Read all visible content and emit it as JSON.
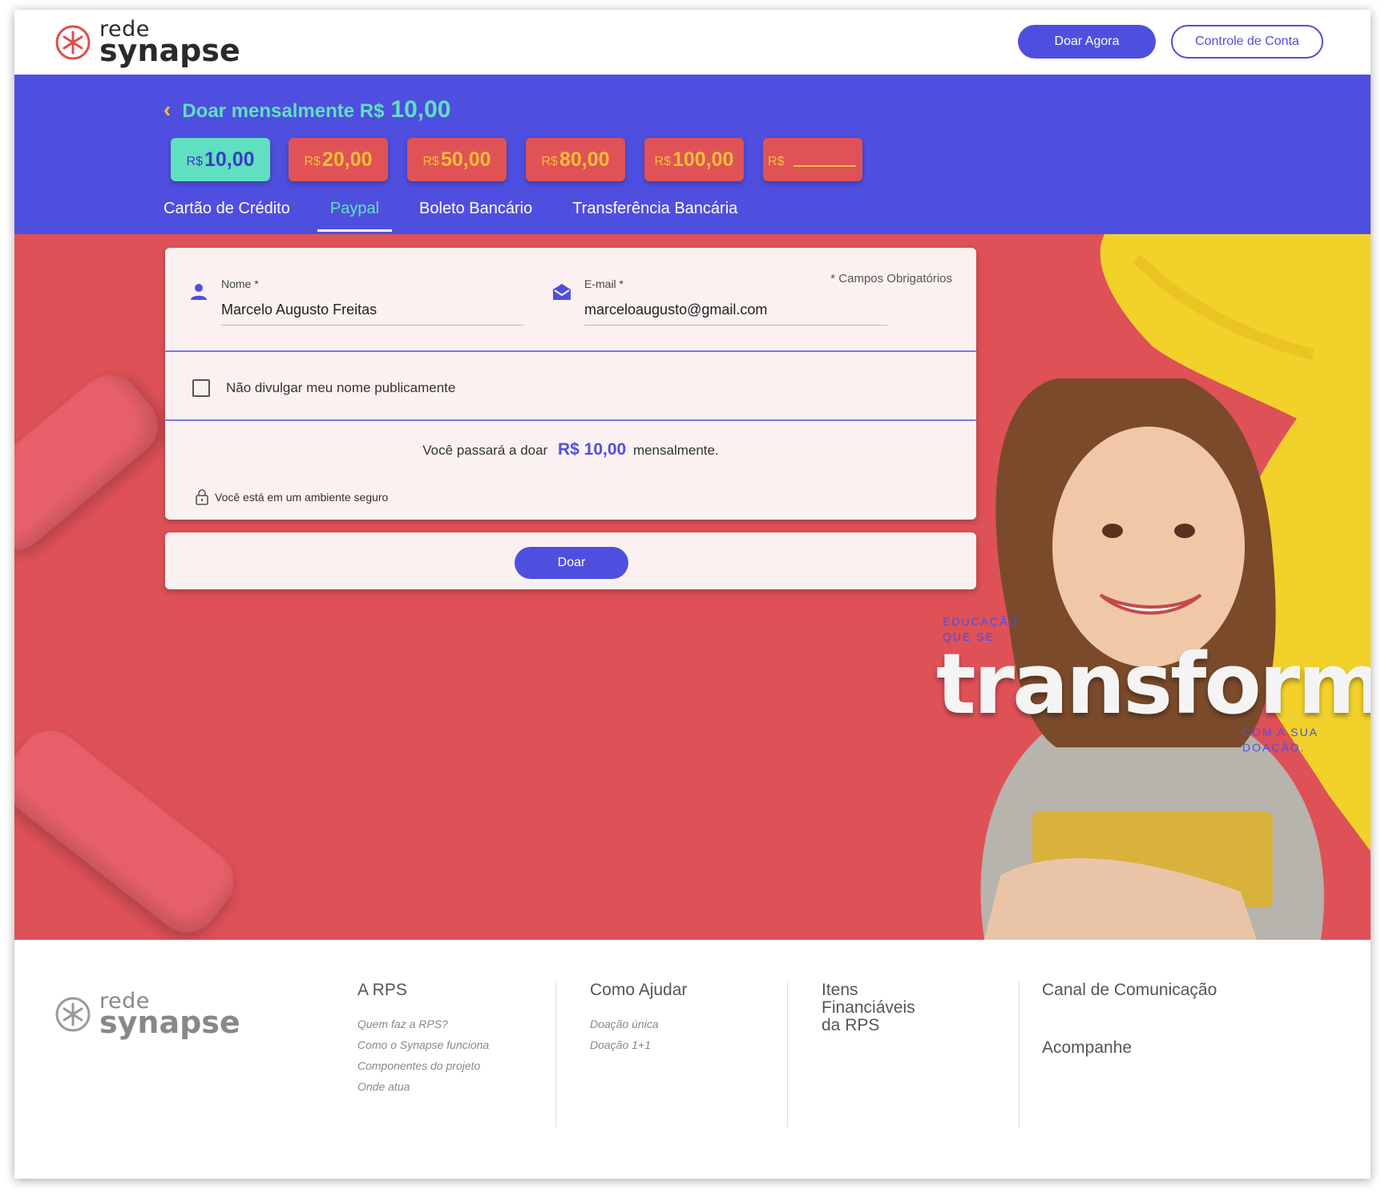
{
  "header": {
    "logo_line1": "rede",
    "logo_line2": "synapse",
    "donate_button": "Doar Agora",
    "account_button": "Controle de Conta"
  },
  "donation": {
    "title": "Doar mensalmente R$",
    "amount": "10,00",
    "currency": "R$",
    "options": [
      {
        "value": "10,00",
        "selected": true
      },
      {
        "value": "20,00",
        "selected": false
      },
      {
        "value": "50,00",
        "selected": false
      },
      {
        "value": "80,00",
        "selected": false
      },
      {
        "value": "100,00",
        "selected": false
      }
    ],
    "custom_currency": "R$"
  },
  "payment_tabs": [
    {
      "label": "Cartão de Crédito",
      "active": false
    },
    {
      "label": "Paypal",
      "active": true
    },
    {
      "label": "Boleto Bancário",
      "active": false
    },
    {
      "label": "Transferência Bancária",
      "active": false
    }
  ],
  "form": {
    "required_note": "* Campos Obrigatórios",
    "name_label": "Nome *",
    "name_value": "Marcelo Augusto Freitas",
    "email_label": "E-mail *",
    "email_value": "marceloaugusto@gmail.com",
    "anonymous_label": "Não divulgar meu nome publicamente",
    "anonymous_checked": false,
    "summary_prefix": "Você passará a doar",
    "summary_amount": "R$ 10,00",
    "summary_suffix": "mensalmente.",
    "secure_text": "Você está em um ambiente seguro",
    "submit_label": "Doar"
  },
  "hero": {
    "slogan_top_1": "EDUCAÇÃO",
    "slogan_top_2": "QUE SE",
    "slogan_main": "transforma",
    "slogan_bottom_1": "COM A SUA",
    "slogan_bottom_2": "DOAÇÃO."
  },
  "footer": {
    "logo_line1": "rede",
    "logo_line2": "synapse",
    "col1": {
      "title": "A RPS",
      "links": [
        "Quem faz a RPS?",
        "Como o Synapse funciona",
        "Componentes do projeto",
        "Onde atua"
      ]
    },
    "col2": {
      "title": "Como Ajudar",
      "links": [
        "Doação única",
        "Doação 1+1"
      ]
    },
    "col3": {
      "title_1": "Itens",
      "title_2": "Financiáveis",
      "title_3": "da RPS"
    },
    "col4": {
      "title": "Canal de Comunicação",
      "title_2": "Acompanhe"
    }
  },
  "colors": {
    "brand_blue": "#4f4fdf",
    "brand_red": "#de5157",
    "accent_green": "#5fe0c0",
    "accent_yellow": "#f3bf36"
  }
}
